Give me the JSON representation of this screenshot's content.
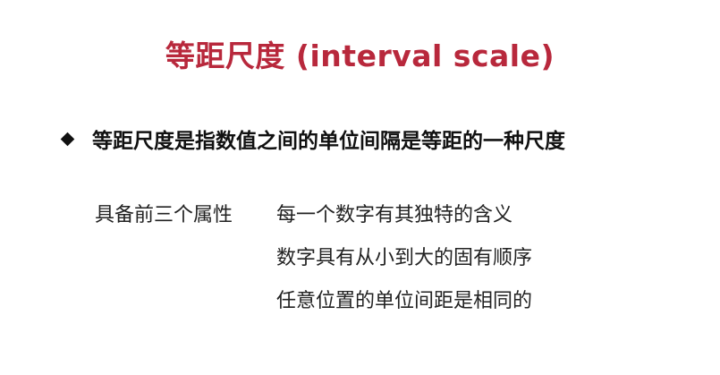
{
  "slide": {
    "title": "等距尺度 (interval scale)",
    "bullet": {
      "icon": "diamond-bullet-icon",
      "text": "等距尺度是指数值之间的单位间隔是等距的一种尺度"
    },
    "properties": {
      "label": "具备前三个属性",
      "items": [
        "每一个数字有其独特的含义",
        "数字具有从小到大的固有顺序",
        "任意位置的单位间距是相同的"
      ]
    }
  },
  "colors": {
    "title": "#b8283c",
    "text": "#111111"
  }
}
